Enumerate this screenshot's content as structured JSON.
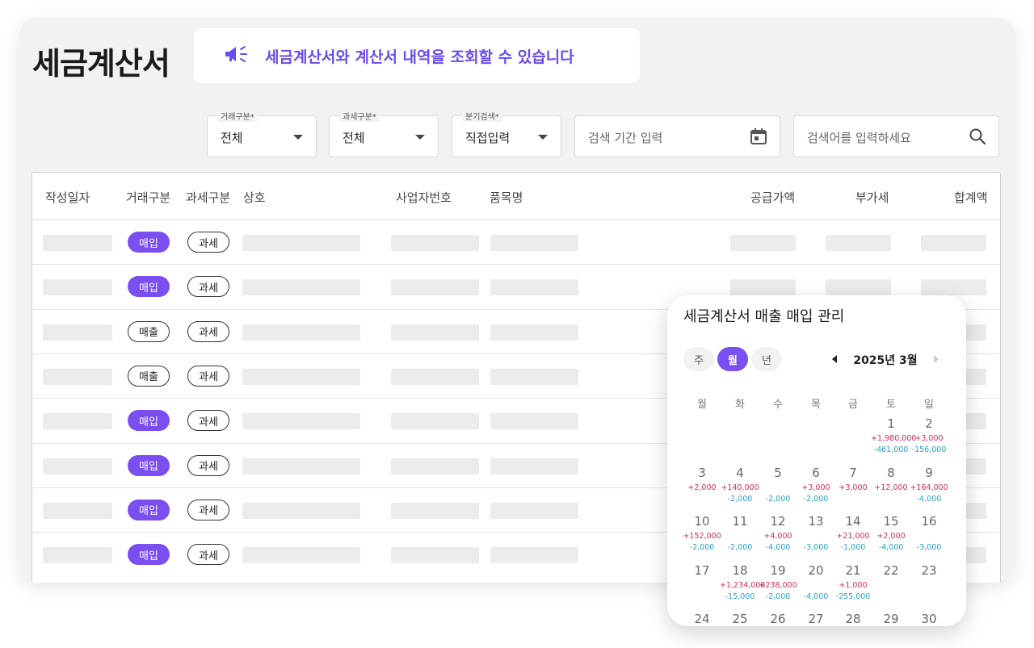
{
  "page": {
    "title": "세금계산서",
    "notice": "세금계산서와 계산서 내역을 조회할 수 있습니다"
  },
  "filters": {
    "trade_type": {
      "label": "거래구분*",
      "value": "전체"
    },
    "tax_type": {
      "label": "과세구분*",
      "value": "전체"
    },
    "quarter": {
      "label": "분기검색*",
      "value": "직접입력"
    },
    "period": {
      "placeholder": "검색 기간 입력"
    },
    "search": {
      "placeholder": "검색어를 입력하세요"
    }
  },
  "table": {
    "headers": [
      "작성일자",
      "거래구분",
      "과세구분",
      "상호",
      "사업자번호",
      "품목명",
      "공급가액",
      "부가세",
      "합계액"
    ],
    "rows": [
      {
        "trade": "매입",
        "tax": "과세"
      },
      {
        "trade": "매입",
        "tax": "과세"
      },
      {
        "trade": "매출",
        "tax": "과세"
      },
      {
        "trade": "매출",
        "tax": "과세"
      },
      {
        "trade": "매입",
        "tax": "과세"
      },
      {
        "trade": "매입",
        "tax": "과세"
      },
      {
        "trade": "매입",
        "tax": "과세"
      },
      {
        "trade": "매입",
        "tax": "과세"
      }
    ]
  },
  "calendar": {
    "title": "세금계산서 매출 매입 관리",
    "tabs": [
      "주",
      "월",
      "년"
    ],
    "active_tab": "월",
    "month": "2025년 3월",
    "weekdays": [
      "월",
      "화",
      "수",
      "목",
      "금",
      "토",
      "일"
    ],
    "weeks": [
      [
        {
          "d": ""
        },
        {
          "d": ""
        },
        {
          "d": ""
        },
        {
          "d": ""
        },
        {
          "d": ""
        },
        {
          "d": "1",
          "plus": "+1,980,000",
          "minus": "-461,000"
        },
        {
          "d": "2",
          "plus": "+3,000",
          "minus": "-156,000"
        }
      ],
      [
        {
          "d": "3",
          "plus": "+2,000"
        },
        {
          "d": "4",
          "plus": "+140,000",
          "minus": "-2,000"
        },
        {
          "d": "5",
          "minus": "-2,000"
        },
        {
          "d": "6",
          "plus": "+3,000",
          "minus": "-2,000"
        },
        {
          "d": "7",
          "plus": "+3,000"
        },
        {
          "d": "8",
          "plus": "+12,000"
        },
        {
          "d": "9",
          "plus": "+164,000",
          "minus": "-4,000"
        }
      ],
      [
        {
          "d": "10",
          "plus": "+152,000",
          "minus": "-2,000"
        },
        {
          "d": "11",
          "minus": "-2,000"
        },
        {
          "d": "12",
          "plus": "+4,000",
          "minus": "-4,000"
        },
        {
          "d": "13",
          "minus": "-3,000"
        },
        {
          "d": "14",
          "plus": "+21,000",
          "minus": "-1,000"
        },
        {
          "d": "15",
          "plus": "+2,000",
          "minus": "-4,000"
        },
        {
          "d": "16",
          "minus": "-3,000"
        }
      ],
      [
        {
          "d": "17"
        },
        {
          "d": "18",
          "plus": "+1,234,000",
          "minus": "-15,000"
        },
        {
          "d": "19",
          "plus": "+238,000",
          "minus": "-2,000"
        },
        {
          "d": "20",
          "minus": "-4,000"
        },
        {
          "d": "21",
          "plus": "+1,000",
          "minus": "-255,000"
        },
        {
          "d": "22"
        },
        {
          "d": "23"
        }
      ],
      [
        {
          "d": "24"
        },
        {
          "d": "25"
        },
        {
          "d": "26"
        },
        {
          "d": "27"
        },
        {
          "d": "28"
        },
        {
          "d": "29"
        },
        {
          "d": "30"
        }
      ]
    ]
  },
  "colors": {
    "accent": "#7b4ef0",
    "income": "#d62a5c",
    "expense": "#2a9fc6"
  },
  "icons": {
    "notice": "megaphone-icon",
    "period": "calendar-icon",
    "search": "search-icon"
  }
}
